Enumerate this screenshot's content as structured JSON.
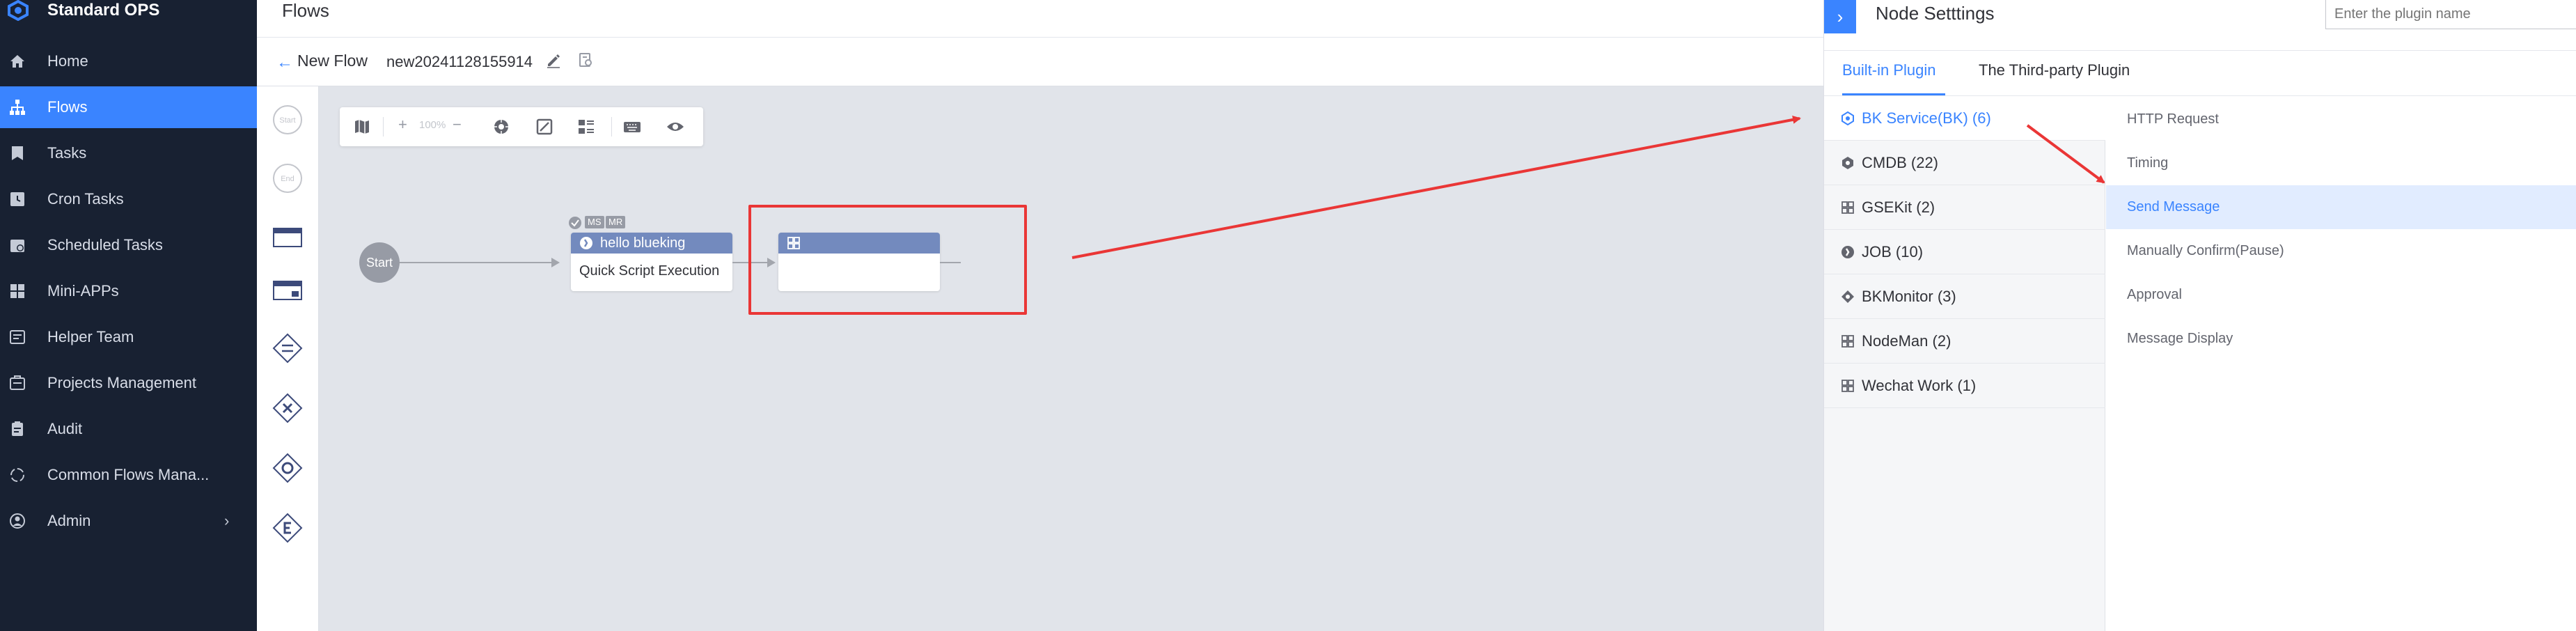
{
  "app": {
    "title": "Standard OPS"
  },
  "nav": [
    {
      "label": "Home",
      "icon": "home-icon"
    },
    {
      "label": "Flows",
      "icon": "flows-icon",
      "active": true
    },
    {
      "label": "Tasks",
      "icon": "tasks-icon"
    },
    {
      "label": "Cron Tasks",
      "icon": "cron-icon"
    },
    {
      "label": "Scheduled Tasks",
      "icon": "scheduled-icon"
    },
    {
      "label": "Mini-APPs",
      "icon": "mini-apps-icon"
    },
    {
      "label": "Helper Team",
      "icon": "helper-team-icon"
    },
    {
      "label": "Projects Management",
      "icon": "projects-icon"
    },
    {
      "label": "Audit",
      "icon": "audit-icon"
    },
    {
      "label": "Common Flows Mana...",
      "icon": "common-flows-icon"
    },
    {
      "label": "Admin",
      "icon": "admin-icon",
      "chevron": "›"
    }
  ],
  "header": {
    "title": "Flows"
  },
  "subheader": {
    "back_arrow": "←",
    "back_label": "New Flow",
    "flow_name": "new20241128155914"
  },
  "palette": {
    "start_label": "Start",
    "end_label": "End"
  },
  "toolbar": {
    "zoom_in": "+",
    "zoom_level": "100%",
    "zoom_out": "−"
  },
  "canvas": {
    "start_node": "Start",
    "badges": [
      "MS",
      "MR"
    ],
    "task_node": {
      "title": "hello blueking",
      "description": "Quick Script Execution"
    }
  },
  "panel": {
    "toggle": "›",
    "title": "Node Setttings",
    "search_placeholder": "Enter the plugin name",
    "tabs": [
      {
        "label": "Built-in Plugin",
        "active": true
      },
      {
        "label": "The Third-party Plugin",
        "active": false
      }
    ],
    "groups": [
      {
        "label": "BK Service(BK) (6)",
        "active": true
      },
      {
        "label": "CMDB (22)"
      },
      {
        "label": "GSEKit (2)"
      },
      {
        "label": "JOB (10)"
      },
      {
        "label": "BKMonitor (3)"
      },
      {
        "label": "NodeMan (2)"
      },
      {
        "label": "Wechat Work (1)"
      }
    ],
    "plugins": [
      {
        "label": "HTTP Request"
      },
      {
        "label": "Timing"
      },
      {
        "label": "Send Message",
        "active": true
      },
      {
        "label": "Manually Confirm(Pause)"
      },
      {
        "label": "Approval"
      },
      {
        "label": "Message Display"
      }
    ]
  },
  "colors": {
    "accent": "#3a84ff",
    "sidebar": "#182132",
    "annotation": "#ea3636",
    "node_header": "#738abe"
  }
}
